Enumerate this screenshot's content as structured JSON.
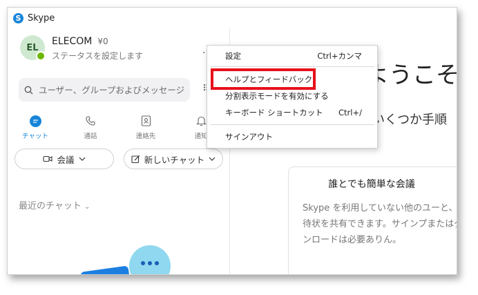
{
  "app": {
    "title": "Skype",
    "logo_letter": "S"
  },
  "profile": {
    "initials": "EL",
    "name": "ELECOM",
    "credit": "¥0",
    "status_prompt": "ステータスを設定します",
    "presence_color": "#6bb700"
  },
  "search": {
    "placeholder": "ユーザー、グループおよびメッセージ"
  },
  "nav": [
    {
      "label": "チャット",
      "icon": "chat-icon",
      "active": true
    },
    {
      "label": "通話",
      "icon": "phone-icon"
    },
    {
      "label": "連絡先",
      "icon": "contacts-icon"
    },
    {
      "label": "通知",
      "icon": "bell-icon"
    }
  ],
  "actions": {
    "meet_label": "会議",
    "new_chat_label": "新しいチャット"
  },
  "recent": {
    "label": "最近のチャット"
  },
  "main": {
    "welcome": "ようこそ!",
    "subtitle": "いくつか手順",
    "card": {
      "title": "誰とでも簡単な会議",
      "description": "Skype を利用していない他のユーと、招待状を共有できます。サインプまたはダウンロードは必要ありん。"
    }
  },
  "menu": {
    "items": [
      {
        "label": "設定",
        "shortcut": "Ctrl+カンマ"
      },
      {
        "label": "ヘルプとフィードバック",
        "shortcut": ""
      },
      {
        "label": "分割表示モードを有効にする",
        "shortcut": ""
      },
      {
        "label": "キーボード ショートカット",
        "shortcut": "Ctrl+/"
      },
      {
        "label": "サインアウト",
        "shortcut": ""
      }
    ]
  },
  "colors": {
    "accent": "#1685d9",
    "highlight": "#e8101a"
  }
}
